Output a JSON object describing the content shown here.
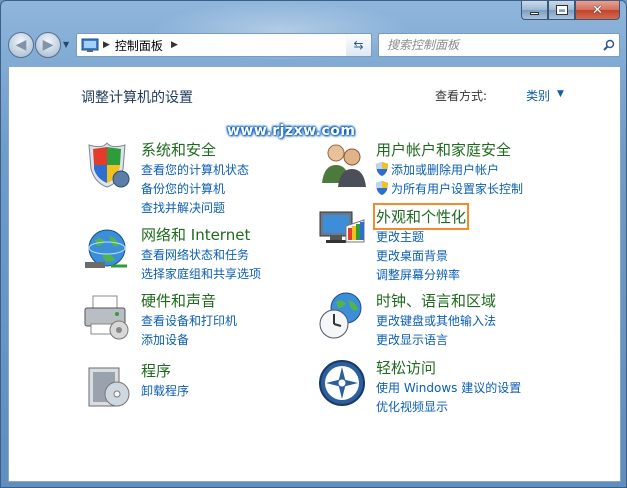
{
  "window": {
    "title": "控制面板"
  },
  "address_bar": {
    "path": "控制面板",
    "search_placeholder": "搜索控制面板"
  },
  "content": {
    "title": "调整计算机的设置",
    "view_by_label": "查看方式:",
    "view_by_value": "类别"
  },
  "watermark": "www.rjzxw.com",
  "categories": {
    "system_security": {
      "title": "系统和安全",
      "links": [
        "查看您的计算机状态",
        "备份您的计算机",
        "查找并解决问题"
      ]
    },
    "network_internet": {
      "title": "网络和 Internet",
      "links": [
        "查看网络状态和任务",
        "选择家庭组和共享选项"
      ]
    },
    "hardware_sound": {
      "title": "硬件和声音",
      "links": [
        "查看设备和打印机",
        "添加设备"
      ]
    },
    "programs": {
      "title": "程序",
      "links": [
        "卸载程序"
      ]
    },
    "user_accounts": {
      "title": "用户帐户和家庭安全",
      "links": [
        "添加或删除用户帐户",
        "为所有用户设置家长控制"
      ]
    },
    "appearance": {
      "title": "外观和个性化",
      "links": [
        "更改主题",
        "更改桌面背景",
        "调整屏幕分辨率"
      ]
    },
    "clock_region": {
      "title": "时钟、语言和区域",
      "links": [
        "更改键盘或其他输入法",
        "更改显示语言"
      ]
    },
    "ease_of_access": {
      "title": "轻松访问",
      "links": [
        "使用 Windows 建议的设置",
        "优化视频显示"
      ]
    }
  },
  "colors": {
    "category_title": "#1f6a1f",
    "link": "#0b5fb5",
    "highlight": "#f28b2c"
  }
}
